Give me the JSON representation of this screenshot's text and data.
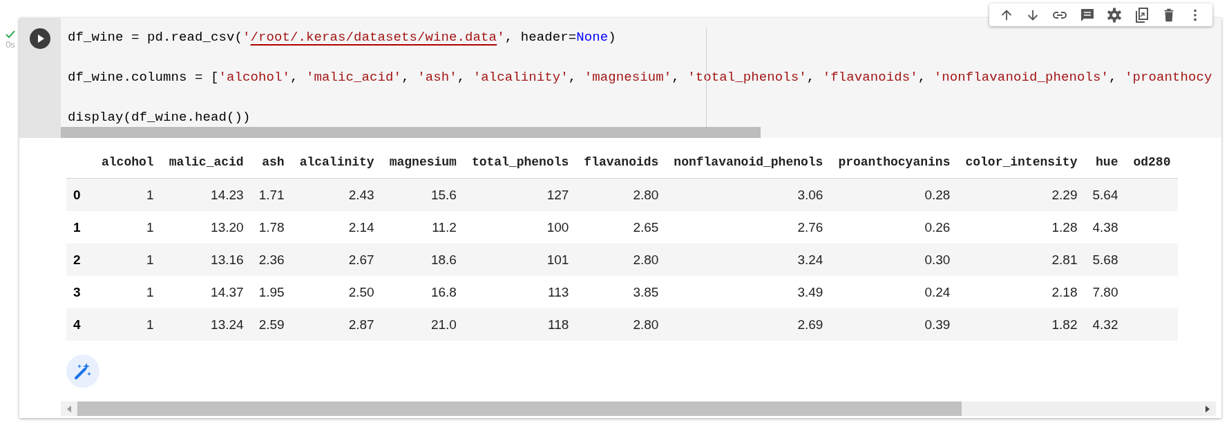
{
  "gutter": {
    "status": "0s"
  },
  "code": {
    "lines": [
      [
        {
          "kind": "plain",
          "text": "df_wine = pd.read_csv("
        },
        {
          "kind": "string",
          "text": "'"
        },
        {
          "kind": "link",
          "text": "/root/.keras/datasets/wine.data"
        },
        {
          "kind": "string",
          "text": "'"
        },
        {
          "kind": "plain",
          "text": ", header="
        },
        {
          "kind": "keyword",
          "text": "None"
        },
        {
          "kind": "plain",
          "text": ")"
        }
      ],
      [
        {
          "kind": "plain",
          "text": "df_wine.columns = ["
        },
        {
          "kind": "string",
          "text": "'alcohol'"
        },
        {
          "kind": "plain",
          "text": ", "
        },
        {
          "kind": "string",
          "text": "'malic_acid'"
        },
        {
          "kind": "plain",
          "text": ", "
        },
        {
          "kind": "string",
          "text": "'ash'"
        },
        {
          "kind": "plain",
          "text": ", "
        },
        {
          "kind": "string",
          "text": "'alcalinity'"
        },
        {
          "kind": "plain",
          "text": ", "
        },
        {
          "kind": "string",
          "text": "'magnesium'"
        },
        {
          "kind": "plain",
          "text": ", "
        },
        {
          "kind": "string",
          "text": "'total_phenols'"
        },
        {
          "kind": "plain",
          "text": ", "
        },
        {
          "kind": "string",
          "text": "'flavanoids'"
        },
        {
          "kind": "plain",
          "text": ", "
        },
        {
          "kind": "string",
          "text": "'nonflavanoid_phenols'"
        },
        {
          "kind": "plain",
          "text": ", "
        },
        {
          "kind": "string",
          "text": "'proanthocy"
        }
      ],
      [
        {
          "kind": "plain",
          "text": "display(df_wine.head())"
        }
      ]
    ]
  },
  "table": {
    "columns": [
      "alcohol",
      "malic_acid",
      "ash",
      "alcalinity",
      "magnesium",
      "total_phenols",
      "flavanoids",
      "nonflavanoid_phenols",
      "proanthocyanins",
      "color_intensity",
      "hue",
      "od280"
    ],
    "rows": [
      {
        "index": "0",
        "cells": [
          "1",
          "14.23",
          "1.71",
          "2.43",
          "15.6",
          "127",
          "2.80",
          "3.06",
          "0.28",
          "2.29",
          "5.64"
        ]
      },
      {
        "index": "1",
        "cells": [
          "1",
          "13.20",
          "1.78",
          "2.14",
          "11.2",
          "100",
          "2.65",
          "2.76",
          "0.26",
          "1.28",
          "4.38"
        ]
      },
      {
        "index": "2",
        "cells": [
          "1",
          "13.16",
          "2.36",
          "2.67",
          "18.6",
          "101",
          "2.80",
          "3.24",
          "0.30",
          "2.81",
          "5.68"
        ]
      },
      {
        "index": "3",
        "cells": [
          "1",
          "14.37",
          "1.95",
          "2.50",
          "16.8",
          "113",
          "3.85",
          "3.49",
          "0.24",
          "2.18",
          "7.80"
        ]
      },
      {
        "index": "4",
        "cells": [
          "1",
          "13.24",
          "2.59",
          "2.87",
          "21.0",
          "118",
          "2.80",
          "2.69",
          "0.39",
          "1.82",
          "4.32"
        ]
      }
    ]
  }
}
